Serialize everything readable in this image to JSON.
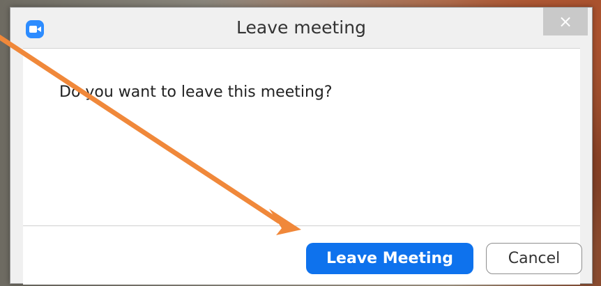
{
  "dialog": {
    "title": "Leave meeting",
    "close_label": "×",
    "message": "Do you want to leave this meeting?",
    "primary_label": "Leave Meeting",
    "secondary_label": "Cancel"
  },
  "icons": {
    "app": "zoom-camera-icon",
    "close": "close-icon",
    "annotation": "arrow-annotation"
  },
  "colors": {
    "primary": "#0e72ed",
    "app_icon": "#2d8cff",
    "arrow": "#f0883a"
  }
}
